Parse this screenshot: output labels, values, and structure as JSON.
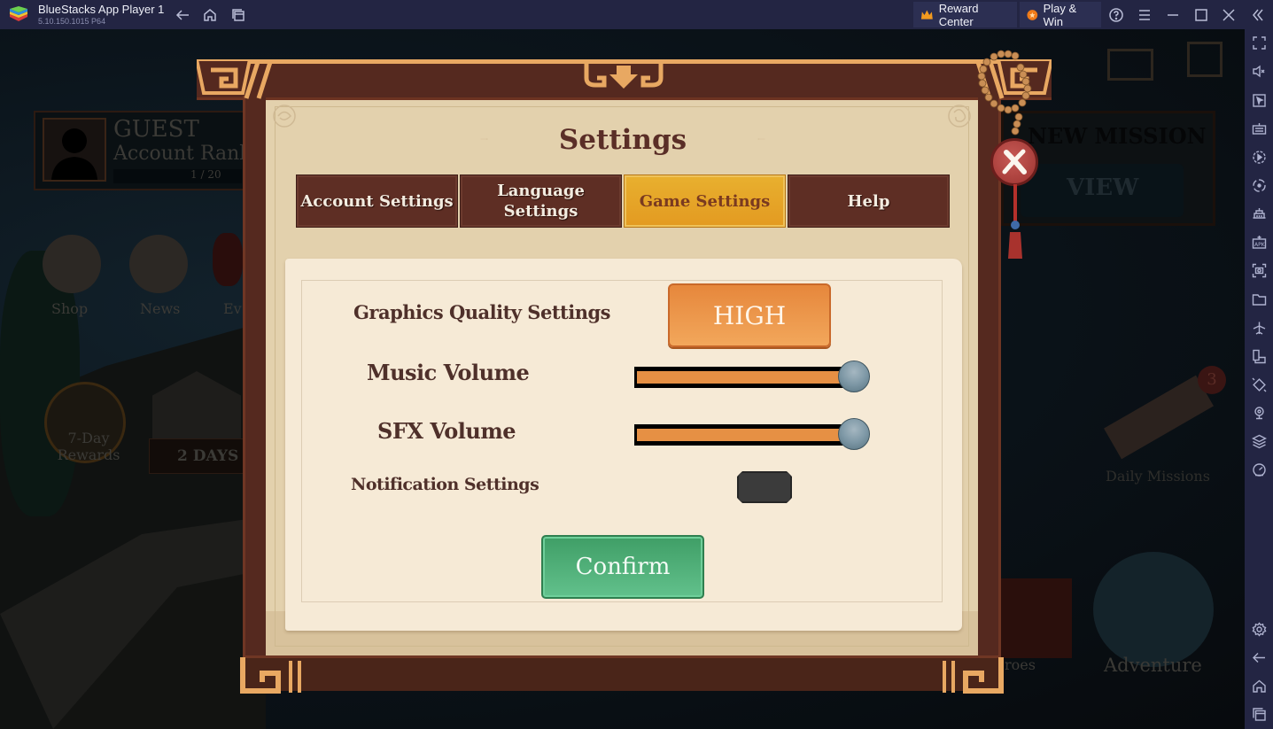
{
  "titlebar": {
    "app_name": "BlueStacks App Player 1",
    "version": "5.10.150.1015  P64",
    "reward_center_label": "Reward Center",
    "play_win_label": "Play & Win"
  },
  "background_game": {
    "player_name": "GUEST",
    "account_rank_label": "Account Rank:",
    "rank_progress_text": "1 / 20",
    "shop_label": "Shop",
    "news_label": "News",
    "events_label_partial": "Ev",
    "seven_day_rewards_label": "7-Day\nRewards",
    "days_label": "2 DAYS",
    "new_mission_label": "NEW MISSION",
    "view_label": "VIEW",
    "daily_missions_label": "Daily Missions",
    "daily_missions_badge": "3",
    "heroes_label_partial": "roes",
    "adventure_label": "Adventure"
  },
  "settings_modal": {
    "title": "Settings",
    "tabs": [
      {
        "label": "Account Settings",
        "active": false
      },
      {
        "label": "Language\nSettings",
        "active": false
      },
      {
        "label": "Game Settings",
        "active": true
      },
      {
        "label": "Help",
        "active": false
      }
    ],
    "graphics_quality": {
      "label": "Graphics Quality Settings",
      "value": "HIGH"
    },
    "music_volume": {
      "label": "Music Volume",
      "value_fraction": 1.0
    },
    "sfx_volume": {
      "label": "SFX Volume",
      "value_fraction": 1.0
    },
    "notification": {
      "label": "Notification Settings",
      "enabled": false
    },
    "confirm_label": "Confirm"
  },
  "colors": {
    "tab_active": "#e3a226",
    "tab_inactive": "#5e2e24",
    "quality_button": "#ec9648",
    "confirm_button": "#52b37b",
    "slider_fill": "#e69044",
    "bluestacks_bar": "#232543"
  }
}
